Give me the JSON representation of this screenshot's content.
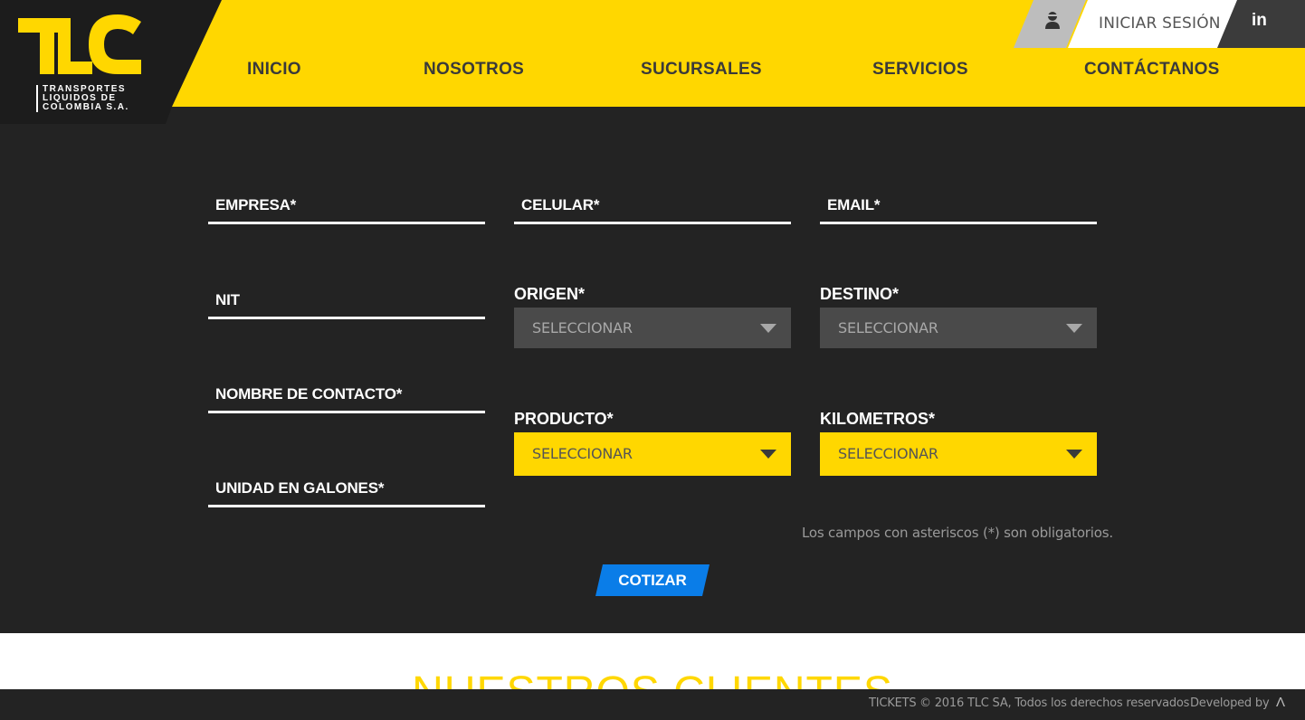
{
  "brand": {
    "logo_letters": "TLC",
    "logo_lines": [
      "TRANSPORTES",
      "LIQUIDOS DE",
      "COLOMBIA S.A."
    ],
    "primary_color": "#ffd700",
    "dark_color": "#232323"
  },
  "header": {
    "login_icon": "user-icon",
    "login_label": "INICIAR SESIÓN",
    "social_label": "in",
    "social_icon": "linkedin-icon",
    "nav": [
      {
        "label": "INICIO"
      },
      {
        "label": "NOSOTROS"
      },
      {
        "label": "SUCURSALES"
      },
      {
        "label": "SERVICIOS"
      },
      {
        "label": "CONTÁCTANOS"
      }
    ]
  },
  "form": {
    "fields": {
      "empresa": "EMPRESA*",
      "celular": "CELULAR*",
      "email": "EMAIL*",
      "nit": "NIT",
      "nombre_contacto": "NOMBRE DE CONTACTO*",
      "unidad_galones": "UNIDAD EN GALONES*"
    },
    "selects": {
      "origen": {
        "label": "ORIGEN*",
        "value": "SELECCIONAR"
      },
      "destino": {
        "label": "DESTINO*",
        "value": "SELECCIONAR"
      },
      "producto": {
        "label": "PRODUCTO*",
        "value": "SELECCIONAR"
      },
      "kilometros": {
        "label": "KILOMETROS*",
        "value": "SELECCIONAR"
      }
    },
    "required_note": "Los campos con asteriscos (*) son obligatorios.",
    "submit_label": "COTIZAR",
    "submit_color": "#0a7de8"
  },
  "clients": {
    "title": "NUESTROS CLIENTES"
  },
  "footer": {
    "tickets_label": "TICKETS",
    "copyright": "© 2016 TLC SA, Todos los derechos reservados",
    "developed_by": "Developed by",
    "dev_logo": "Λ"
  }
}
